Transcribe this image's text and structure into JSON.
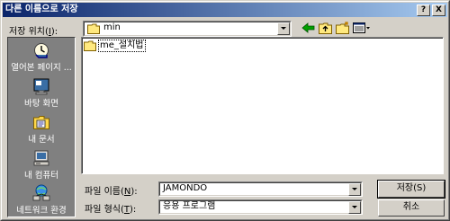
{
  "window": {
    "title": "다른 이름으로 저장",
    "help_btn": "?",
    "close_btn": "X"
  },
  "location": {
    "label_pre": "저장 위치(",
    "label_key": "I",
    "label_post": "):",
    "value": "min"
  },
  "toolbar": {
    "icons": [
      "back-arrow-icon",
      "up-folder-icon",
      "new-folder-icon",
      "view-menu-icon"
    ]
  },
  "places": [
    {
      "label": "열어본 페이지 ...",
      "icon": "history-icon"
    },
    {
      "label": "바탕 화면",
      "icon": "desktop-icon"
    },
    {
      "label": "내 문서",
      "icon": "my-documents-icon"
    },
    {
      "label": "내 컴퓨터",
      "icon": "my-computer-icon"
    },
    {
      "label": "네트워크 환경",
      "icon": "network-icon"
    }
  ],
  "files": [
    {
      "name": "me_설치법",
      "icon": "folder-icon"
    }
  ],
  "filename": {
    "label_pre": "파일 이름(",
    "label_key": "N",
    "label_post": "):",
    "value": "JAMONDO"
  },
  "filetype": {
    "label_pre": "파일 형식(",
    "label_key": "T",
    "label_post": "):",
    "value": "응용 프로그램"
  },
  "buttons": {
    "save": "저장(S)",
    "cancel": "취소"
  },
  "colors": {
    "title_start": "#0a246a",
    "title_end": "#a6caf0",
    "face": "#d4d0c8",
    "places_bg": "#808080"
  }
}
